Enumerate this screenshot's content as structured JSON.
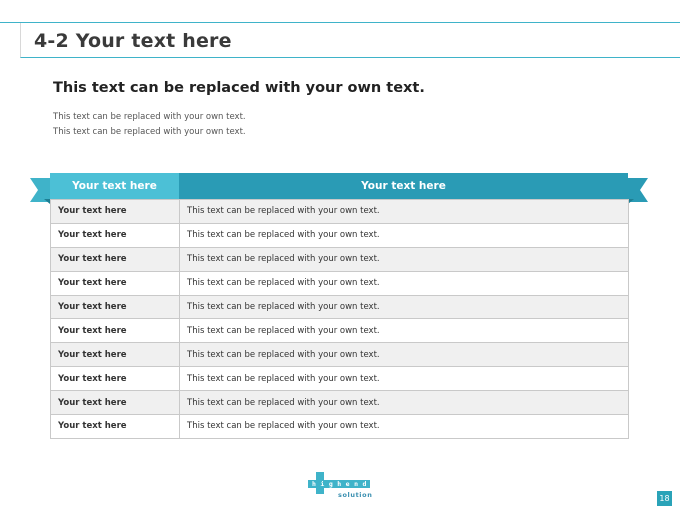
{
  "slide": {
    "title": "4-2 Your text here",
    "subtitle": "This text can be replaced with your own text.",
    "body_lines": [
      "This text can be replaced with your own text.",
      "This text can be replaced with your own text."
    ],
    "page_number": "18"
  },
  "table": {
    "headers": [
      "Your text here",
      "Your text here"
    ],
    "rows": [
      [
        "Your text here",
        "This text can be replaced with your own text."
      ],
      [
        "Your text here",
        "This text can be replaced with your own text."
      ],
      [
        "Your text here",
        "This text can be replaced with your own text."
      ],
      [
        "Your text here",
        "This text can be replaced with your own text."
      ],
      [
        "Your text here",
        "This text can be replaced with your own text."
      ],
      [
        "Your text here",
        "This text can be replaced with your own text."
      ],
      [
        "Your text here",
        "This text can be replaced with your own text."
      ],
      [
        "Your text here",
        "This text can be replaced with your own text."
      ],
      [
        "Your text here",
        "This text can be replaced with your own text."
      ],
      [
        "Your text here",
        "This text can be replaced with your own text."
      ]
    ]
  },
  "logo": {
    "word": "highend",
    "sub": "solution"
  },
  "colors": {
    "accent": "#3fb3c9",
    "header_dark": "#2a9bb5",
    "header_light": "#4cc0d6"
  }
}
